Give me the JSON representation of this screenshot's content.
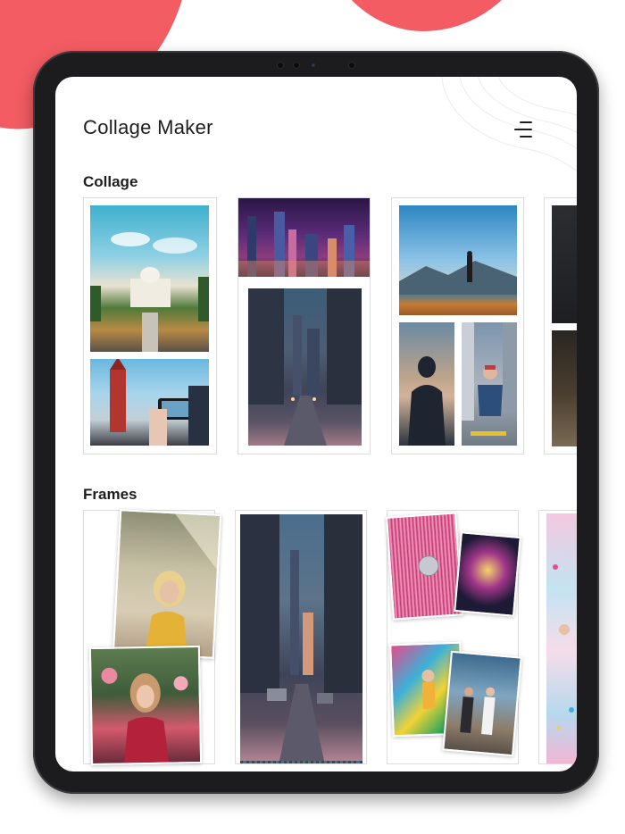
{
  "app": {
    "title": "Collage Maker",
    "menu_icon": "menu-icon"
  },
  "sections": {
    "collage_title": "Collage",
    "frames_title": "Frames"
  },
  "colors": {
    "accent": "#f25c62",
    "device": "#1c1c1e",
    "text": "#1d1d1f"
  },
  "collage_templates": [
    {
      "name": "collage-template-1",
      "photos": [
        "palace-garden",
        "red-tower-phone"
      ]
    },
    {
      "name": "collage-template-2",
      "photos": [
        "night-city-skyline",
        "city-street-dusk"
      ]
    },
    {
      "name": "collage-template-3",
      "photos": [
        "hiker-mountain-view",
        "silhouette-sunset",
        "skater-city"
      ]
    },
    {
      "name": "collage-template-4",
      "photos": [
        "dark-portrait",
        "dark-plants"
      ]
    }
  ],
  "frame_templates": [
    {
      "name": "frame-template-1",
      "photos": [
        "blonde-woman",
        "woman-flowers"
      ]
    },
    {
      "name": "frame-template-2",
      "photos": [
        "city-street-stamp"
      ]
    },
    {
      "name": "frame-template-3",
      "photos": [
        "disco-ball-tinsel",
        "fireworks-night",
        "colorful-mural",
        "friends-street"
      ]
    },
    {
      "name": "frame-template-4",
      "photos": [
        "pastel-party"
      ]
    }
  ]
}
